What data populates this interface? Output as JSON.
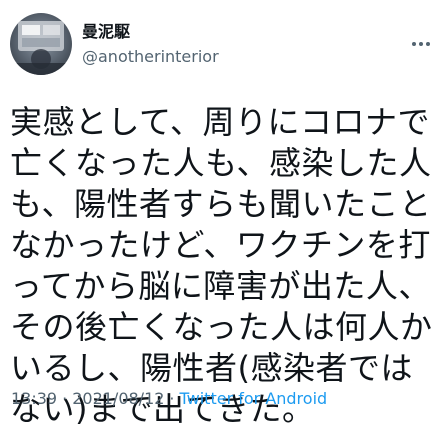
{
  "author": {
    "display_name": "曼泥駆",
    "handle": "@anotherinterior",
    "avatar_icon": "profile-photo"
  },
  "tweet": {
    "text": "実感として、周りにコロナで亡くなった人も、感染した人も、陽性者すらも聞いたことなかったけど、ワクチンを打ってから脳に障害が出た人、その後亡くなった人は何人かいるし、陽性者(感染者ではない)まで出てきた。"
  },
  "meta": {
    "time": "13:39",
    "separator": "·",
    "date": "2021/08/12",
    "source": "Twitter for Android"
  },
  "colors": {
    "text": "#0f1419",
    "secondary": "#536471",
    "link": "#1d9bf0"
  },
  "icons": {
    "more": "more-horizontal-icon"
  }
}
